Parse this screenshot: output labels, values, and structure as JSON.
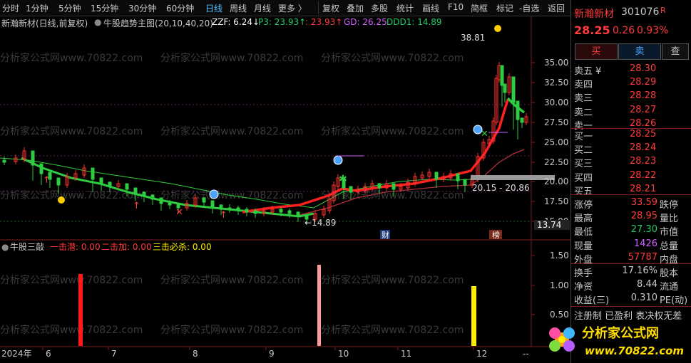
{
  "toolbar": {
    "periods": [
      "分时",
      "1分钟",
      "5分钟",
      "15分钟",
      "30分钟",
      "60分钟",
      "日线",
      "周线",
      "月线",
      "更多 〉"
    ],
    "active": "日线",
    "tools": [
      "复权",
      "叠加",
      "多股",
      "统计",
      "画线",
      "F10",
      "简框",
      "标记",
      "-自选",
      "返回"
    ]
  },
  "header": {
    "stock_label": "新瀚新材(日线,前复权)",
    "indicator": "牛股趋势主图(20,10,40,20)",
    "zzf": "ZZF: 6.24↓",
    "p3": "P3: 23.93↑",
    "p4": ": 23.93↑",
    "gd": "GD: 26.25",
    "ddd1": "DDD1: 14.89"
  },
  "price_axis": {
    "ticks": [
      "35.00",
      "32.50",
      "30.00",
      "27.50",
      "25.00",
      "22.50",
      "20.00",
      "17.50",
      "15.00"
    ],
    "current": "13.74"
  },
  "annotations": {
    "high_label": "38.81",
    "low_label": "←14.89",
    "range_label": "20.15 - 20.86",
    "fin_tag": "财",
    "list_tag": "榜"
  },
  "watermark": "分析家公式网www.70822.com",
  "sub_header": {
    "name": "牛股三敲",
    "l1": "一击潜: 0.00",
    "l2": "二击加: 0.00",
    "l3": "三击必杀: 0.00"
  },
  "sub_axis": [
    "1.50",
    "1.00",
    "0.50"
  ],
  "x_axis": [
    "2024年",
    "6",
    "7",
    "8",
    "9",
    "10",
    "11",
    "12",
    "--"
  ],
  "quote": {
    "name": "新瀚新材",
    "code": "301076",
    "badge": "R",
    "price": "28.25",
    "change": "0.26",
    "pct": "0.93%",
    "buy": "买",
    "sell": "卖",
    "query": "查",
    "asks": [
      {
        "label": "卖五 ¥",
        "price": "28.30"
      },
      {
        "label": "卖四",
        "price": "28.29"
      },
      {
        "label": "卖三",
        "price": "28.28"
      },
      {
        "label": "卖二",
        "price": "28.27"
      },
      {
        "label": "卖一",
        "price": "28.26"
      }
    ],
    "bids": [
      {
        "label": "买一",
        "price": "28.25"
      },
      {
        "label": "买二",
        "price": "28.24"
      },
      {
        "label": "买三",
        "price": "28.23"
      },
      {
        "label": "买四",
        "price": "28.22"
      },
      {
        "label": "买五",
        "price": "28.21"
      }
    ],
    "stats": [
      {
        "l": "涨停",
        "v": "33.59",
        "v_color": "#ff3b3b",
        "r": "跌停"
      },
      {
        "l": "最高",
        "v": "28.95",
        "v_color": "#ff3b3b",
        "r": "量比"
      },
      {
        "l": "最低",
        "v": "27.30",
        "v_color": "#22cc66",
        "r": "市值"
      },
      {
        "l": "现量",
        "v": "1426",
        "v_color": "#d060ff",
        "r": "总量"
      },
      {
        "l": "外盘",
        "v": "57787",
        "v_color": "#ff3b3b",
        "r": "内盘"
      }
    ],
    "stats2": [
      {
        "l": "换手",
        "v": "17.16%",
        "r": "股本"
      },
      {
        "l": "净资",
        "v": "8.44",
        "r": "流通"
      },
      {
        "l": "收益(三)",
        "v": "0.310",
        "r": "PE(动)"
      }
    ],
    "tags": "注册制 已盈利 表决权无差"
  },
  "logo": {
    "text": "分析家公式网",
    "url": "www.70822.com"
  }
}
